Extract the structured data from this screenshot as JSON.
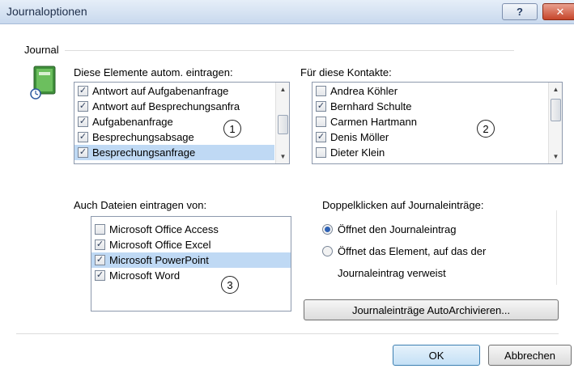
{
  "window": {
    "title": "Journaloptionen",
    "help_label": "?",
    "close_label": "✕"
  },
  "group_title": "Journal",
  "auto_entries": {
    "label": "Diese Elemente autom. eintragen:",
    "items": [
      {
        "label": "Antwort auf Aufgabenanfrage",
        "checked": true,
        "check": "✓"
      },
      {
        "label": "Antwort auf Besprechungsanfra",
        "checked": true,
        "check": "✓"
      },
      {
        "label": "Aufgabenanfrage",
        "checked": true,
        "check": "✓"
      },
      {
        "label": "Besprechungsabsage",
        "checked": true,
        "check": "✓"
      },
      {
        "label": "Besprechungsanfrage",
        "checked": true,
        "check": "✓",
        "selected": true
      }
    ],
    "marker": "1"
  },
  "contacts": {
    "label": "Für diese Kontakte:",
    "items": [
      {
        "label": "Andrea Köhler",
        "checked": false,
        "check": ""
      },
      {
        "label": "Bernhard Schulte",
        "checked": true,
        "check": "✓"
      },
      {
        "label": "Carmen Hartmann",
        "checked": false,
        "check": ""
      },
      {
        "label": "Denis Möller",
        "checked": true,
        "check": "✓"
      },
      {
        "label": "Dieter Klein",
        "checked": false,
        "check": ""
      }
    ],
    "marker": "2"
  },
  "files": {
    "label": "Auch Dateien eintragen von:",
    "items": [
      {
        "label": "Microsoft Office Access",
        "checked": false,
        "check": ""
      },
      {
        "label": "Microsoft Office Excel",
        "checked": true,
        "check": "✓"
      },
      {
        "label": "Microsoft PowerPoint",
        "checked": true,
        "check": "✓",
        "selected": true
      },
      {
        "label": "Microsoft Word",
        "checked": true,
        "check": "✓"
      }
    ],
    "marker": "3"
  },
  "double_click": {
    "label": "Doppelklicken auf Journaleinträge:",
    "options": [
      {
        "label": "Öffnet den Journaleintrag",
        "selected": true
      },
      {
        "label": "Öffnet das Element, auf das der",
        "selected": false
      }
    ],
    "option2_continuation": "Journaleintrag verweist"
  },
  "buttons": {
    "autoarchive": "Journaleinträge AutoArchivieren...",
    "ok": "OK",
    "cancel": "Abbrechen"
  },
  "colors": {
    "selection": "#bfd9f4",
    "title_bar": "#c9d9ee",
    "close_button": "#c6452a"
  }
}
